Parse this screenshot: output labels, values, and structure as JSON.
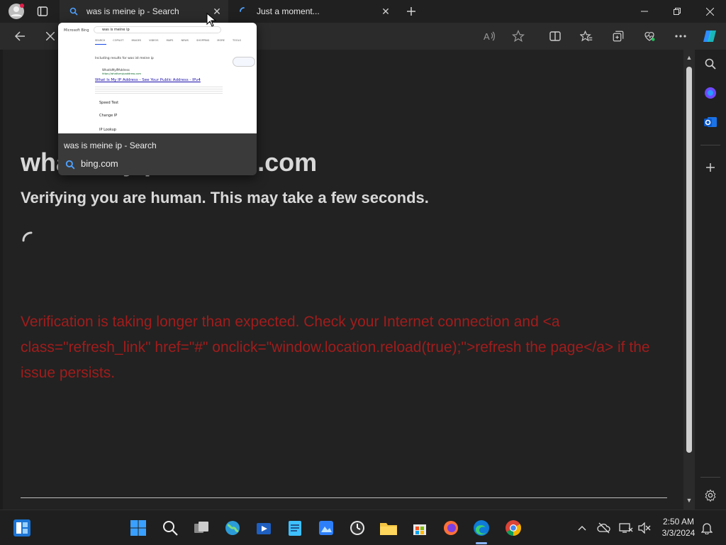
{
  "tabs": [
    {
      "title": "was is meine ip - Search",
      "active": true
    },
    {
      "title": "Just a moment...",
      "active": false,
      "loading": true
    }
  ],
  "tab_preview": {
    "title": "was is meine ip - Search",
    "domain": "bing.com",
    "thumbnail": {
      "brand": "Microsoft Bing",
      "query": "was is meine ip",
      "nav": [
        "SEARCH",
        "COPILOT",
        "IMAGES",
        "VIDEOS",
        "MAPS",
        "NEWS",
        "SHOPPING",
        "MORE",
        "TOOLS"
      ],
      "including": "Including results for was ist meine ip",
      "result_title": "What Is My IP Address - See Your Public Address - IPv4",
      "site_name": "WhatIsMyIPAddress",
      "site_url": "https://whatismyipaddress.com",
      "sublinks": [
        "Speed Test",
        "Change IP",
        "IP Lookup"
      ]
    }
  },
  "page": {
    "site_title": "whatismyipaddress.com",
    "verify_text": "Verifying you are human. This may take a few seconds.",
    "error_text": "Verification is taking longer than expected. Check your Internet connection and <a class=\"refresh_link\" href=\"#\" onclick=\"window.location.reload(true);\">refresh the page</a> if the issue persists."
  },
  "taskbar": {
    "time": "2:50 AM",
    "date": "3/3/2024"
  },
  "colors": {
    "error_red": "#a11c1c",
    "accent_blue": "#3b82f6",
    "page_bg": "#222222"
  }
}
